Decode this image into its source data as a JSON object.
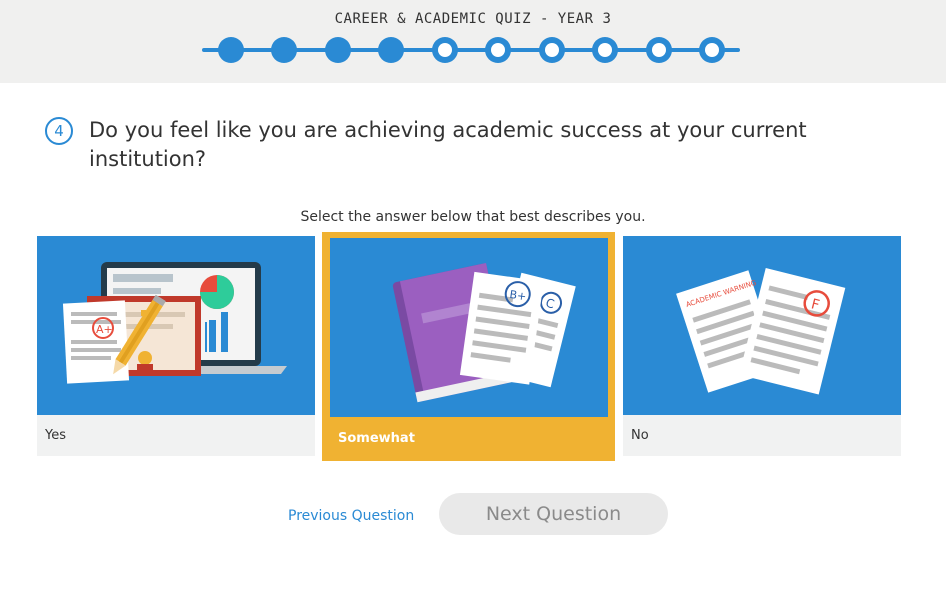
{
  "header": {
    "title": "CAREER & ACADEMIC QUIZ - YEAR 3",
    "progress": {
      "total": 10,
      "completed": 4,
      "color": "#2a8ad4"
    }
  },
  "question": {
    "number": "4",
    "text": "Do you feel like you are achieving academic success at your current institution?"
  },
  "instruction": "Select the answer below that best describes you.",
  "answers": [
    {
      "label": "Yes",
      "illustration": "laptop-certificate-grade-a-icon",
      "selected": false,
      "image_text": "A+"
    },
    {
      "label": "Somewhat",
      "illustration": "book-papers-grade-b-c-icon",
      "selected": true,
      "image_text": [
        "B+",
        "C"
      ]
    },
    {
      "label": "No",
      "illustration": "academic-warning-papers-grade-f-icon",
      "selected": false,
      "image_text": [
        "ACADEMIC WARNING",
        "F"
      ]
    }
  ],
  "nav": {
    "previous_label": "Previous Question",
    "next_label": "Next Question"
  },
  "colors": {
    "accent": "#2a8ad4",
    "selected": "#f0b232",
    "background_header": "#f0f0ef"
  }
}
